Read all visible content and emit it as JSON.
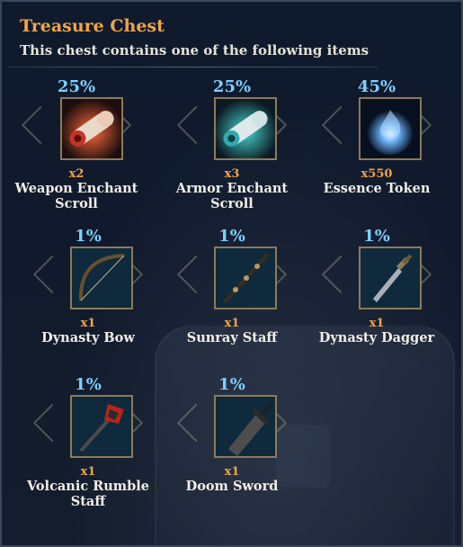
{
  "header": {
    "title": "Treasure Chest",
    "subtitle": "This chest contains one of the following items"
  },
  "items": [
    {
      "name": "Weapon Enchant Scroll",
      "quantity": "x2",
      "chance": "25%",
      "icon": "red-scroll-icon",
      "accent": "#d8452f"
    },
    {
      "name": "Armor Enchant Scroll",
      "quantity": "x3",
      "chance": "25%",
      "icon": "teal-scroll-icon",
      "accent": "#34c3c6"
    },
    {
      "name": "Essence Token",
      "quantity": "x550",
      "chance": "45%",
      "icon": "blue-essence-icon",
      "accent": "#5aa6ff"
    },
    {
      "name": "Dynasty Bow",
      "quantity": "x1",
      "chance": "1%",
      "icon": "bow-icon",
      "accent": "#6b4e2c"
    },
    {
      "name": "Sunray Staff",
      "quantity": "x1",
      "chance": "1%",
      "icon": "staff-icon",
      "accent": "#b59b68"
    },
    {
      "name": "Dynasty Dagger",
      "quantity": "x1",
      "chance": "1%",
      "icon": "dagger-icon",
      "accent": "#a9b0b8"
    },
    {
      "name": "Volcanic Rumble Staff",
      "quantity": "x1",
      "chance": "1%",
      "icon": "volcanic-staff-icon",
      "accent": "#b8231b"
    },
    {
      "name": "Doom Sword",
      "quantity": "x1",
      "chance": "1%",
      "icon": "sword-icon",
      "accent": "#4d4d4d"
    }
  ],
  "colors": {
    "title": "#f0a44a",
    "chance": "#7fd0ff",
    "quantity": "#f0a44a",
    "frame": "#8d7a59"
  }
}
